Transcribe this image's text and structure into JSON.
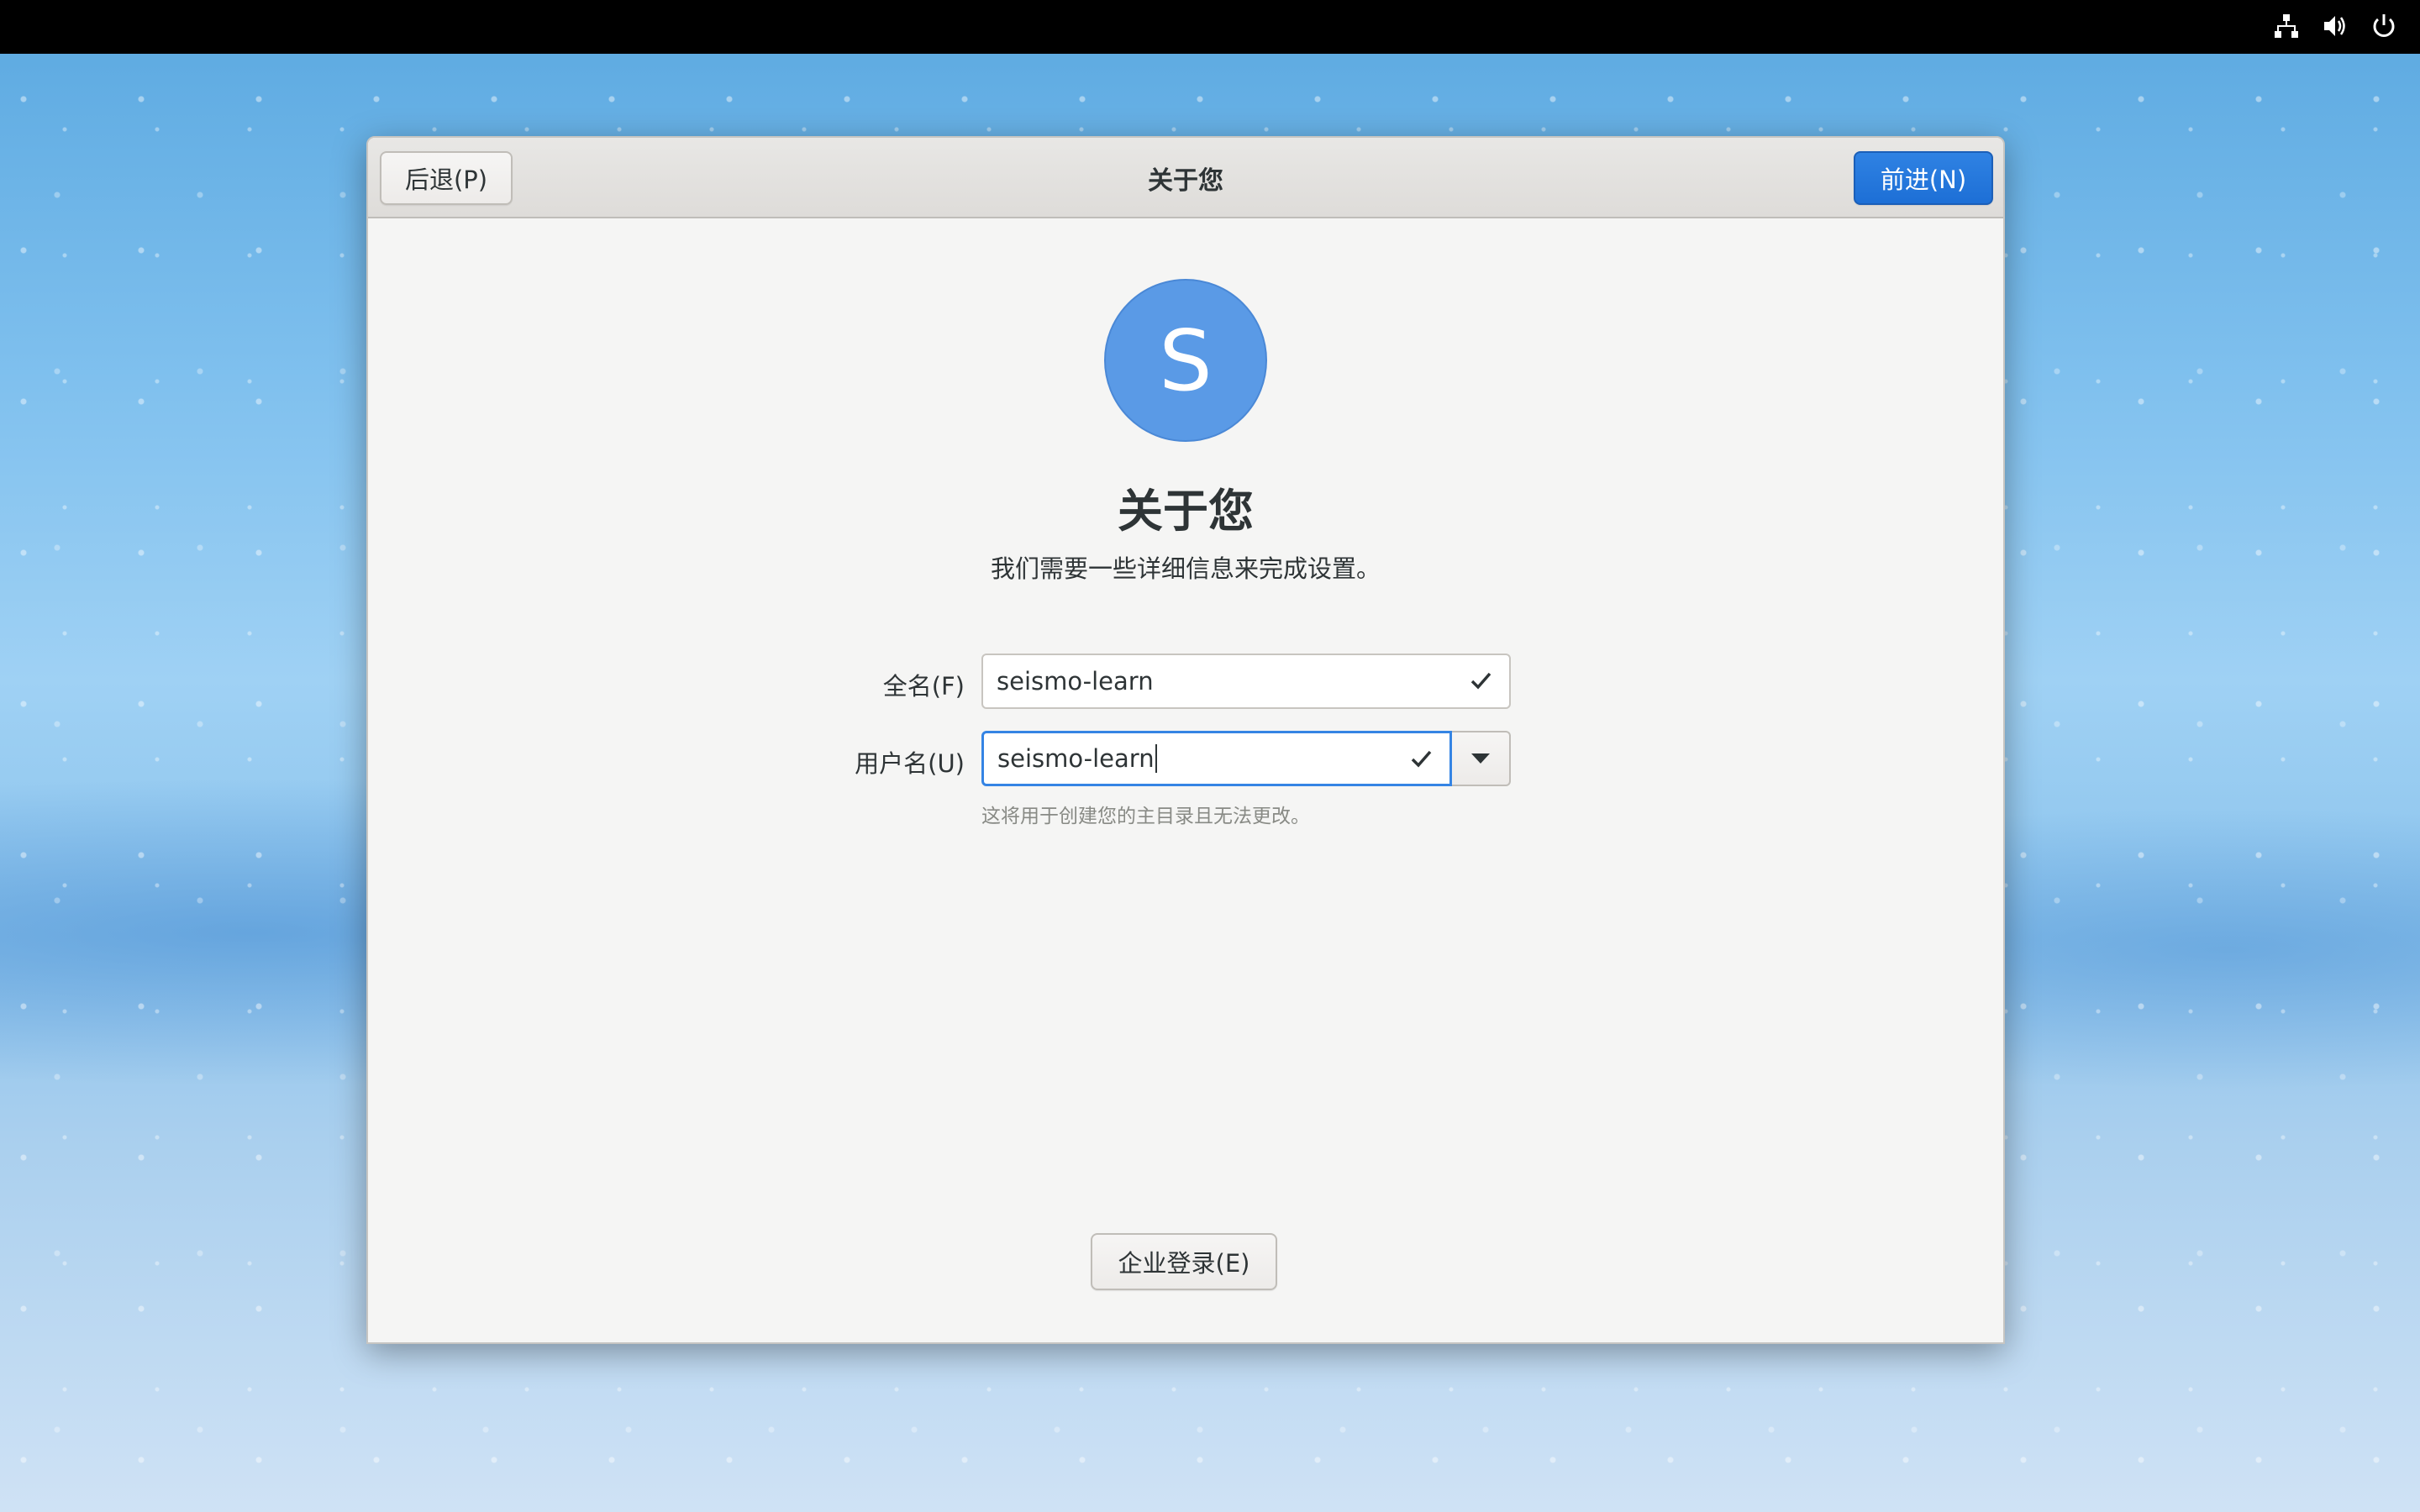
{
  "top_bar": {
    "tray_icons": [
      "network-icon",
      "volume-icon",
      "power-icon"
    ]
  },
  "dialog": {
    "back_label": "后退(P)",
    "title": "关于您",
    "next_label": "前进(N)",
    "avatar_letter": "S",
    "heading": "关于您",
    "subheading": "我们需要一些详细信息来完成设置。",
    "full_name": {
      "label": "全名(F)",
      "value": "seismo-learn"
    },
    "username": {
      "label": "用户名(U)",
      "value": "seismo-learn",
      "hint": "这将用于创建您的主目录且无法更改。"
    },
    "enterprise_label": "企业登录(E)"
  },
  "colors": {
    "accent": "#3584e4",
    "next_button": "#1d6fd6",
    "avatar": "#5a9ae6"
  }
}
